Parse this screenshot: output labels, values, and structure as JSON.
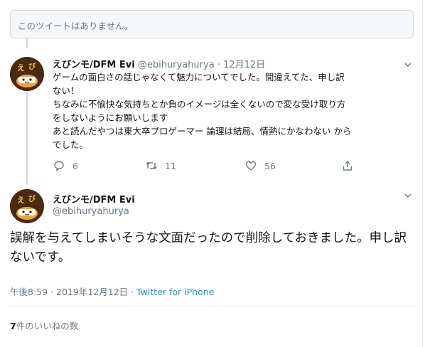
{
  "unavailable_notice": "このツイートはありません。",
  "tweet1": {
    "name": "えびンモ/DFM Evi",
    "handle": "@ebihuryahurya",
    "separator": "·",
    "date": "12月12日",
    "lines": [
      "ゲームの面白さの話じゃなくて魅力についてでした。間違えてた、申し訳",
      "ない！",
      "ちなみに不愉快な気持ちとか負のイメージは全くないので変な受け取り方",
      "をしないようにお願いします",
      "あと読んだやつは東大卒プロゲーマー 論理は結局、情熱にかなわない から",
      "でした。"
    ],
    "reply_count": "6",
    "retweet_count": "11",
    "like_count": "56",
    "icons": [
      "reply-icon",
      "retweet-icon",
      "heart-icon",
      "share-icon"
    ]
  },
  "tweet2": {
    "name": "えびンモ/DFM Evi",
    "handle": "@ebihuryahurya",
    "text": "誤解を与えてしまいそうな文面だったので削除しておきました。申し訳ないです。",
    "time": "午後8:59",
    "separator": "·",
    "date": "2019年12月12日",
    "client": "Twitter for iPhone",
    "likes_count": "7",
    "likes_suffix": "件のいいねの数"
  },
  "colors": {
    "text": "#14171a",
    "muted": "#657786",
    "link": "#1b95e0",
    "border": "#e6ecf0"
  }
}
